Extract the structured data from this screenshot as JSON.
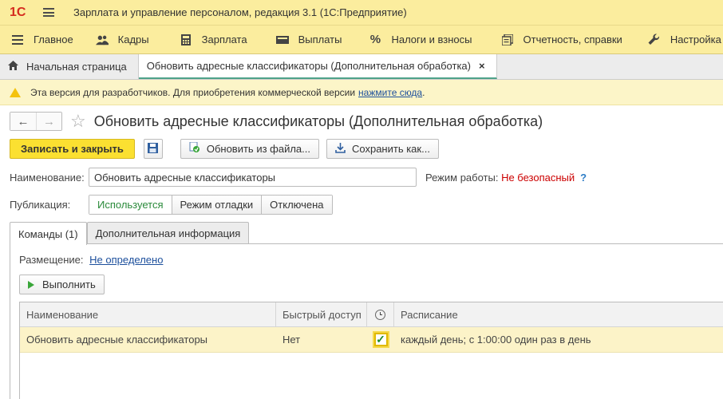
{
  "app": {
    "logo": "1С",
    "title": "Зарплата и управление персоналом, редакция 3.1  (1С:Предприятие)"
  },
  "sections": [
    {
      "label": "Главное",
      "icon": "menu-lines-icon"
    },
    {
      "label": "Кадры",
      "icon": "people-icon"
    },
    {
      "label": "Зарплата",
      "icon": "calculator-icon"
    },
    {
      "label": "Выплаты",
      "icon": "cash-icon"
    },
    {
      "label": "Налоги и взносы",
      "icon": "percent-icon"
    },
    {
      "label": "Отчетность, справки",
      "icon": "reports-icon"
    },
    {
      "label": "Настройка",
      "icon": "wrench-icon"
    }
  ],
  "open_tabs": [
    {
      "label": "Начальная страница"
    },
    {
      "label": "Обновить адресные классификаторы (Дополнительная обработка)",
      "close": "×"
    }
  ],
  "notice": {
    "text": "Эта версия для разработчиков. Для приобретения коммерческой версии",
    "link": "нажмите сюда",
    "suffix": "."
  },
  "form": {
    "title": "Обновить адресные классификаторы (Дополнительная обработка)",
    "buttons": {
      "save_close": "Записать и закрыть",
      "update_from_file": "Обновить из файла...",
      "save_as": "Сохранить как..."
    },
    "name_label": "Наименование:",
    "name_value": "Обновить адресные классификаторы",
    "mode_label": "Режим работы:",
    "mode_value": "Не безопасный",
    "mode_help": "?",
    "publication_label": "Публикация:",
    "publication_options": [
      "Используется",
      "Режим отладки",
      "Отключена"
    ],
    "publication_selected": "Используется",
    "tabs": [
      "Команды (1)",
      "Дополнительная информация"
    ],
    "placement_label": "Размещение:",
    "placement_value": "Не определено",
    "run_button": "Выполнить"
  },
  "commands_table": {
    "columns": [
      "Наименование",
      "Быстрый доступ",
      "",
      "Расписание"
    ],
    "rows": [
      {
        "name": "Обновить адресные классификаторы",
        "quick_access": "Нет",
        "scheduled": true,
        "schedule": "каждый день; с 1:00:00 один раз в день"
      }
    ]
  },
  "colors": {
    "header_bg": "#fbed9e",
    "primary_button": "#fbe031",
    "active_green": "#2a8a3a",
    "danger_red": "#cc0000",
    "link_blue": "#1c4f9c"
  }
}
